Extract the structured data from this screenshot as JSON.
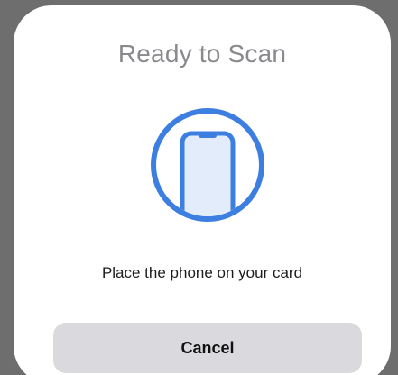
{
  "sheet": {
    "title": "Ready to Scan",
    "icon": "phone-scan-icon",
    "message": "Place the phone on your card",
    "cancel_label": "Cancel"
  },
  "colors": {
    "accent": "#3d7fe0",
    "phone_fill": "#e3ecfb",
    "title_text": "#8a8a8e",
    "button_bg": "#d9d9de"
  }
}
